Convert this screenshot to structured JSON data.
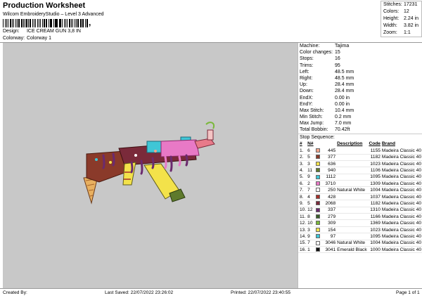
{
  "header": {
    "title": "Production Worksheet",
    "subtitle": "Wilcom EmbroideryStudio – Level 3 Advanced",
    "design_label": "Design:",
    "design_value": "ICE CREAM GUN 3,8 IN",
    "colorway_label": "Colorway:",
    "colorway_value": "Colorway 1"
  },
  "stats": [
    {
      "label": "Stitches:",
      "value": "17231"
    },
    {
      "label": "Colors:",
      "value": "12"
    },
    {
      "label": "Height:",
      "value": "2.24 in"
    },
    {
      "label": "Width:",
      "value": "3.82 in"
    },
    {
      "label": "Zoom:",
      "value": "1:1"
    }
  ],
  "machine_info": [
    {
      "label": "Machine:",
      "value": "Tajima"
    },
    {
      "label": "Color changes:",
      "value": "15"
    },
    {
      "label": "Stops:",
      "value": "16"
    },
    {
      "label": "Trims:",
      "value": "95"
    },
    {
      "label": "Left:",
      "value": "48.5 mm"
    },
    {
      "label": "Right:",
      "value": "48.5 mm"
    },
    {
      "label": "Up:",
      "value": "28.4 mm"
    },
    {
      "label": "Down:",
      "value": "28.4 mm"
    },
    {
      "label": "EndX:",
      "value": "0.00 in"
    },
    {
      "label": "EndY:",
      "value": "0.00 in"
    },
    {
      "label": "Max Stitch:",
      "value": "10.4 mm"
    },
    {
      "label": "Min Stitch:",
      "value": "0.2 mm"
    },
    {
      "label": "Max Jump:",
      "value": "7.0 mm"
    },
    {
      "label": "Total Bobbin:",
      "value": "70.42ft"
    }
  ],
  "stop_sequence": {
    "title": "Stop Sequence:",
    "headers": {
      "stop": "#",
      "n": "N#",
      "sw": "",
      "st": "",
      "desc": "Description",
      "code": "Code",
      "brand": "Brand"
    },
    "rows": [
      {
        "stop": "1.",
        "n": "6",
        "color": "#f4a48a",
        "st": "445",
        "desc": "",
        "code": "1155",
        "brand": "Madeira Classic 40"
      },
      {
        "stop": "2.",
        "n": "5",
        "color": "#8a3a2a",
        "st": "377",
        "desc": "",
        "code": "1182",
        "brand": "Madeira Classic 40"
      },
      {
        "stop": "3.",
        "n": "3",
        "color": "#f3e24a",
        "st": "636",
        "desc": "",
        "code": "1023",
        "brand": "Madeira Classic 40"
      },
      {
        "stop": "4.",
        "n": "11",
        "color": "#5e7a2c",
        "st": "940",
        "desc": "",
        "code": "1106",
        "brand": "Madeira Classic 40"
      },
      {
        "stop": "5.",
        "n": "9",
        "color": "#3fc6d6",
        "st": "1112",
        "desc": "",
        "code": "1095",
        "brand": "Madeira Classic 40"
      },
      {
        "stop": "6.",
        "n": "2",
        "color": "#e879c6",
        "st": "3710",
        "desc": "",
        "code": "1309",
        "brand": "Madeira Classic 40"
      },
      {
        "stop": "7.",
        "n": "7",
        "color": "#ffffff",
        "st": "250",
        "desc": "Natural White",
        "code": "1004",
        "brand": "Madeira Classic 40"
      },
      {
        "stop": "8.",
        "n": "4",
        "color": "#a8302a",
        "st": "428",
        "desc": "",
        "code": "1037",
        "brand": "Madeira Classic 40"
      },
      {
        "stop": "9.",
        "n": "5",
        "color": "#7a2a3a",
        "st": "2068",
        "desc": "",
        "code": "1182",
        "brand": "Madeira Classic 40"
      },
      {
        "stop": "10.",
        "n": "12",
        "color": "#6b2a6e",
        "st": "337",
        "desc": "",
        "code": "1310",
        "brand": "Madeira Classic 40"
      },
      {
        "stop": "11.",
        "n": "8",
        "color": "#3a5e2a",
        "st": "279",
        "desc": "",
        "code": "1166",
        "brand": "Madeira Classic 40"
      },
      {
        "stop": "12.",
        "n": "10",
        "color": "#7ab83a",
        "st": "309",
        "desc": "",
        "code": "1369",
        "brand": "Madeira Classic 40"
      },
      {
        "stop": "13.",
        "n": "3",
        "color": "#f3e24a",
        "st": "154",
        "desc": "",
        "code": "1023",
        "brand": "Madeira Classic 40"
      },
      {
        "stop": "14.",
        "n": "9",
        "color": "#3fc6d6",
        "st": "97",
        "desc": "",
        "code": "1095",
        "brand": "Madeira Classic 40"
      },
      {
        "stop": "15.",
        "n": "7",
        "color": "#ffffff",
        "st": "3046",
        "desc": "Natural White",
        "code": "1004",
        "brand": "Madeira Classic 40"
      },
      {
        "stop": "16.",
        "n": "1",
        "color": "#111111",
        "st": "3041",
        "desc": "Emerald Black",
        "code": "1000",
        "brand": "Madeira Classic 40"
      }
    ]
  },
  "footer": {
    "created_by": "Created By:",
    "last_saved": "Last Saved: 22/07/2022 23:26:02",
    "printed": "Printed: 22/07/2022 23:40:55",
    "page": "Page 1 of 1"
  }
}
